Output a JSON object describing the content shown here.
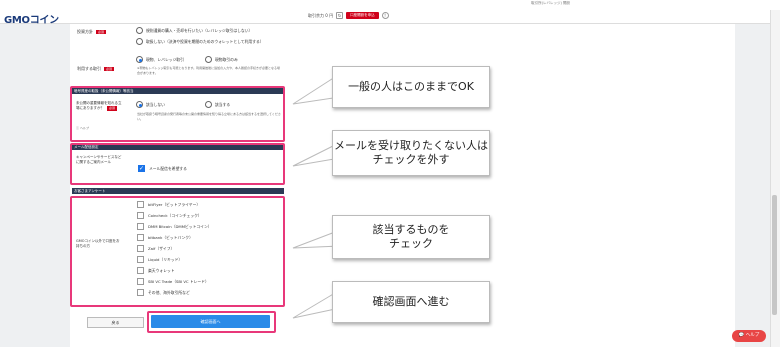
{
  "header": {
    "logo_gmo": "GMO",
    "logo_coin": "コイン",
    "top_links": "取引所(レバレッジ)  開設",
    "balance_label": "取引余力 0 円",
    "cta": "口座開設を申込"
  },
  "sections": {
    "purpose": {
      "label": "投資方針",
      "req": "必須",
      "options": [
        "規則通貨の購入・売却を行いたい（レバレッジ取引はしない）",
        "取扱しない（決済や投資を期間のためのウォレットとして利用する）"
      ]
    },
    "trading": {
      "label": "利用する取引",
      "req": "必須",
      "options": [
        "現物、レバレッジ取引",
        "現物取引のみ"
      ],
      "note": "※現物もレバレッジ取引も可能となります。利用開始後に追加の入力や、本人確認の手続きが必要となる場合があります。"
    },
    "insider": {
      "bar": "暗号資産の取扱（未公開情報）等該当",
      "label": "未公開の重要情報を知れる立場にありますか？",
      "help": "ヘルプ",
      "req": "必須",
      "options": [
        "該当しない",
        "該当する"
      ],
      "note": "当社が取扱う暗号資産の発行者等の未公開の重要情報を知り得る立場にある方は該当するを選択してください。"
    },
    "mail": {
      "bar": "メール配信設定",
      "label": "キャンペーンやサービスなどに関するご案内メール",
      "checkbox": "メール配信を希望する"
    },
    "survey": {
      "bar": "お客さまアンケート",
      "label": "GMOコイン以外で口座をお持ちの方",
      "options": [
        "bitFlyer（ビットフライヤー）",
        "Coincheck（コインチェック）",
        "DMM Bitcoin（DMMビットコイン）",
        "bitbank（ビットバンク）",
        "Zaif（ザイフ）",
        "Liquid（リキッド）",
        "楽天ウォレット",
        "SBI VC Trade（SBI VC トレード）",
        "その他、海外取引所など"
      ]
    }
  },
  "buttons": {
    "back": "戻る",
    "confirm": "確認画面へ",
    "help": "ヘルプ"
  },
  "callouts": [
    "一般の人はこのままでOK",
    "メールを受け取りたくない人は\nチェックを外す",
    "該当するものを\nチェック",
    "確認画面へ進む"
  ],
  "colors": {
    "accent": "#e8387a",
    "primary": "#2a8be8",
    "brand": "#1a3a7a",
    "required": "#d0021b"
  }
}
